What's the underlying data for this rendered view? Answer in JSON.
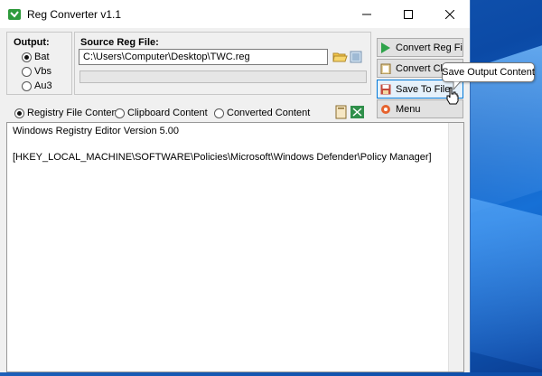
{
  "window": {
    "title": "Reg Converter v1.1"
  },
  "output": {
    "label": "Output:",
    "options": [
      {
        "label": "Bat",
        "selected": true
      },
      {
        "label": "Vbs",
        "selected": false
      },
      {
        "label": "Au3",
        "selected": false
      }
    ]
  },
  "source": {
    "label": "Source Reg File:",
    "path": "C:\\Users\\Computer\\Desktop\\TWC.reg"
  },
  "view": {
    "options": [
      {
        "label": "Registry File Content",
        "selected": true
      },
      {
        "label": "Clipboard Content",
        "selected": false
      },
      {
        "label": "Converted Content",
        "selected": false
      }
    ]
  },
  "actions": {
    "convert_reg_file": "Convert Reg File",
    "convert_clip": "Convert Clip ...",
    "save_to_file": "Save To File",
    "menu": "Menu"
  },
  "content": {
    "lines": [
      "Windows Registry Editor Version 5.00",
      "[HKEY_LOCAL_MACHINE\\SOFTWARE\\Policies\\Microsoft\\Windows Defender\\Policy Manager]"
    ]
  },
  "tooltip": "Save Output Content",
  "colors": {
    "accent": "#0078d7",
    "desktop": "#0b4aa6",
    "window_bg": "#f0f0f0"
  }
}
